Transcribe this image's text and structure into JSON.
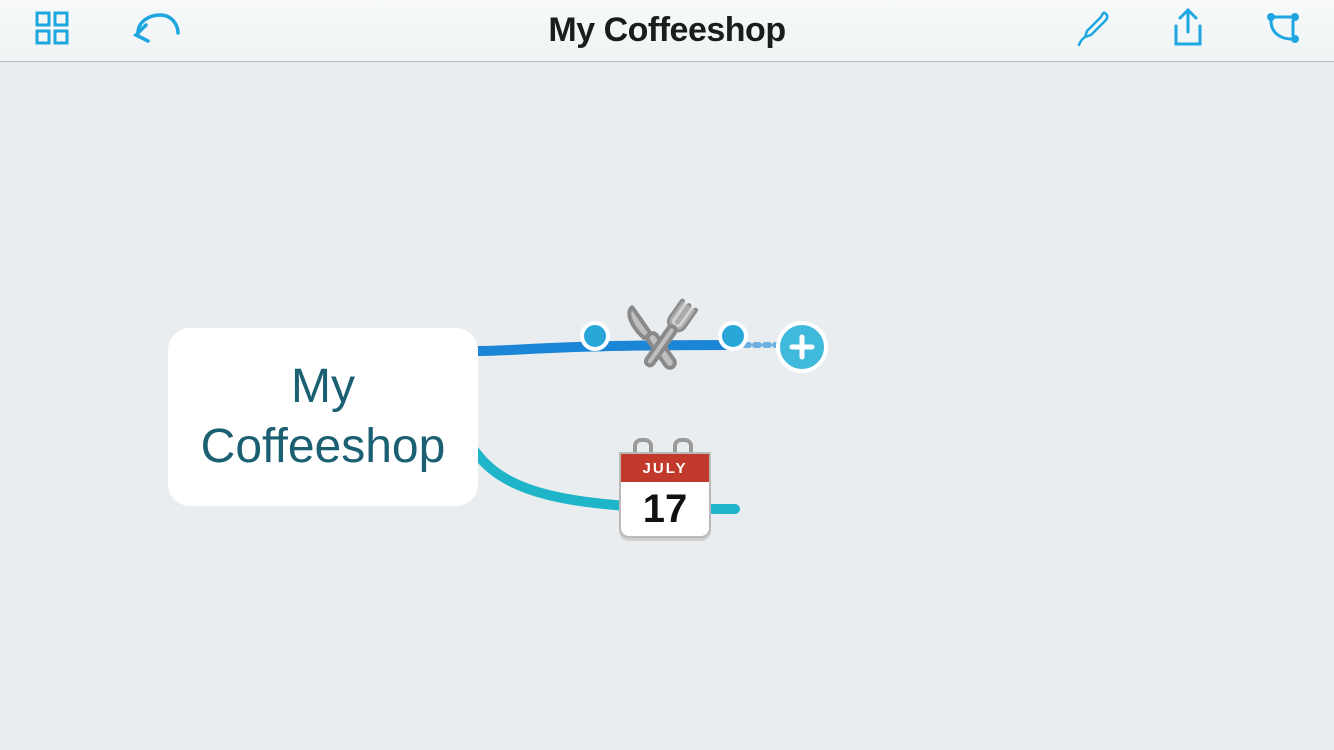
{
  "header": {
    "title": "My Coffeeshop"
  },
  "toolbar": {
    "home_icon": "grid",
    "undo_icon": "undo",
    "style_icon": "brush",
    "share_icon": "share",
    "layout_icon": "layout"
  },
  "mindmap": {
    "root": {
      "label": "My\nCoffeeshop"
    },
    "children": [
      {
        "id": "food",
        "icon": "utensils",
        "selected": true,
        "branch_color": "#1b85d6",
        "add_button": true
      },
      {
        "id": "date",
        "icon": "calendar",
        "calendar": {
          "month": "JULY",
          "day": "17"
        },
        "selected": false,
        "branch_color": "#1fb5c9"
      }
    ]
  },
  "colors": {
    "accent": "#1ea6e0",
    "branch_top": "#1b85d6",
    "branch_bottom": "#1fb5c9",
    "canvas_bg": "#e9edef"
  }
}
